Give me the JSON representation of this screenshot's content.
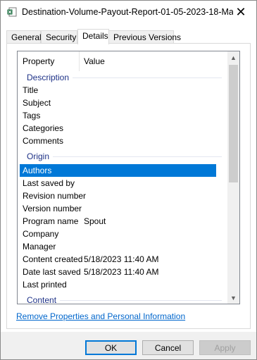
{
  "window": {
    "title": "Destination-Volume-Payout-Report-01-05-2023-18-Ma...",
    "close_label": "✕",
    "icon": "excel-file-icon"
  },
  "tabs": [
    {
      "label": "General"
    },
    {
      "label": "Security"
    },
    {
      "label": "Details",
      "active": true
    },
    {
      "label": "Previous Versions"
    }
  ],
  "list": {
    "columns": {
      "property": "Property",
      "value": "Value"
    },
    "groups": {
      "description": "Description",
      "origin": "Origin",
      "content": "Content"
    },
    "rows": [
      {
        "prop": "Title",
        "val": ""
      },
      {
        "prop": "Subject",
        "val": ""
      },
      {
        "prop": "Tags",
        "val": ""
      },
      {
        "prop": "Categories",
        "val": ""
      },
      {
        "prop": "Comments",
        "val": ""
      },
      {
        "prop": "Authors",
        "val": "",
        "selected": true
      },
      {
        "prop": "Last saved by",
        "val": ""
      },
      {
        "prop": "Revision number",
        "val": ""
      },
      {
        "prop": "Version number",
        "val": ""
      },
      {
        "prop": "Program name",
        "val": "Spout"
      },
      {
        "prop": "Company",
        "val": ""
      },
      {
        "prop": "Manager",
        "val": ""
      },
      {
        "prop": "Content created",
        "val": "5/18/2023 11:40 AM"
      },
      {
        "prop": "Date last saved",
        "val": "5/18/2023 11:40 AM"
      },
      {
        "prop": "Last printed",
        "val": ""
      }
    ]
  },
  "link": "Remove Properties and Personal Information",
  "buttons": {
    "ok": "OK",
    "cancel": "Cancel",
    "apply": "Apply"
  },
  "colors": {
    "selection": "#0078d7",
    "link": "#0066cc",
    "group_title": "#1e3287"
  }
}
